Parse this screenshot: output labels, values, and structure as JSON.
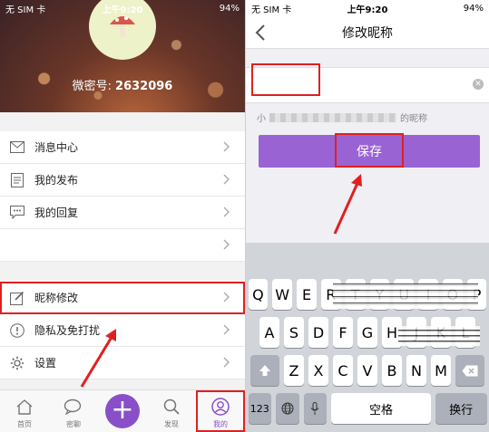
{
  "left": {
    "status": {
      "carrier": "无 SIM 卡",
      "time": "上午9:20",
      "battery": "94%"
    },
    "profile": {
      "id_label": "微密号:",
      "id_value": "2632096"
    },
    "menu_group1": [
      {
        "label": "消息中心",
        "icon": "mail-icon"
      },
      {
        "label": "我的发布",
        "icon": "document-icon"
      },
      {
        "label": "我的回复",
        "icon": "chat-icon"
      },
      {
        "label": "",
        "icon": ""
      }
    ],
    "menu_group2": [
      {
        "label": "昵称修改",
        "icon": "edit-icon"
      },
      {
        "label": "隐私及免打扰",
        "icon": "info-icon"
      },
      {
        "label": "设置",
        "icon": "gear-icon"
      }
    ],
    "tabs": [
      {
        "label": "首页",
        "icon": "home-icon"
      },
      {
        "label": "密聊",
        "icon": "chat-bubbles-icon"
      },
      {
        "label": "",
        "icon": "plus-icon"
      },
      {
        "label": "发现",
        "icon": "search-icon"
      },
      {
        "label": "我的",
        "icon": "profile-icon"
      }
    ],
    "accent": "#8a4fc8"
  },
  "right": {
    "status": {
      "carrier": "无 SIM 卡",
      "time": "上午9:20",
      "battery": "94%"
    },
    "nav_title": "修改昵称",
    "nickname_value": "",
    "hint_prefix": "小",
    "hint_suffix": "的昵称",
    "save_label": "保存",
    "keyboard": {
      "row1": [
        "Q",
        "W",
        "E",
        "R",
        "T",
        "Y",
        "U",
        "I",
        "O",
        "P"
      ],
      "row2": [
        "A",
        "S",
        "D",
        "F",
        "G",
        "H",
        "J",
        "K",
        "L"
      ],
      "row3": [
        "Z",
        "X",
        "C",
        "V",
        "B",
        "N",
        "M"
      ],
      "num_label": "123",
      "space_label": "空格",
      "return_label": "换行"
    },
    "button_color": "#9a63d4"
  }
}
